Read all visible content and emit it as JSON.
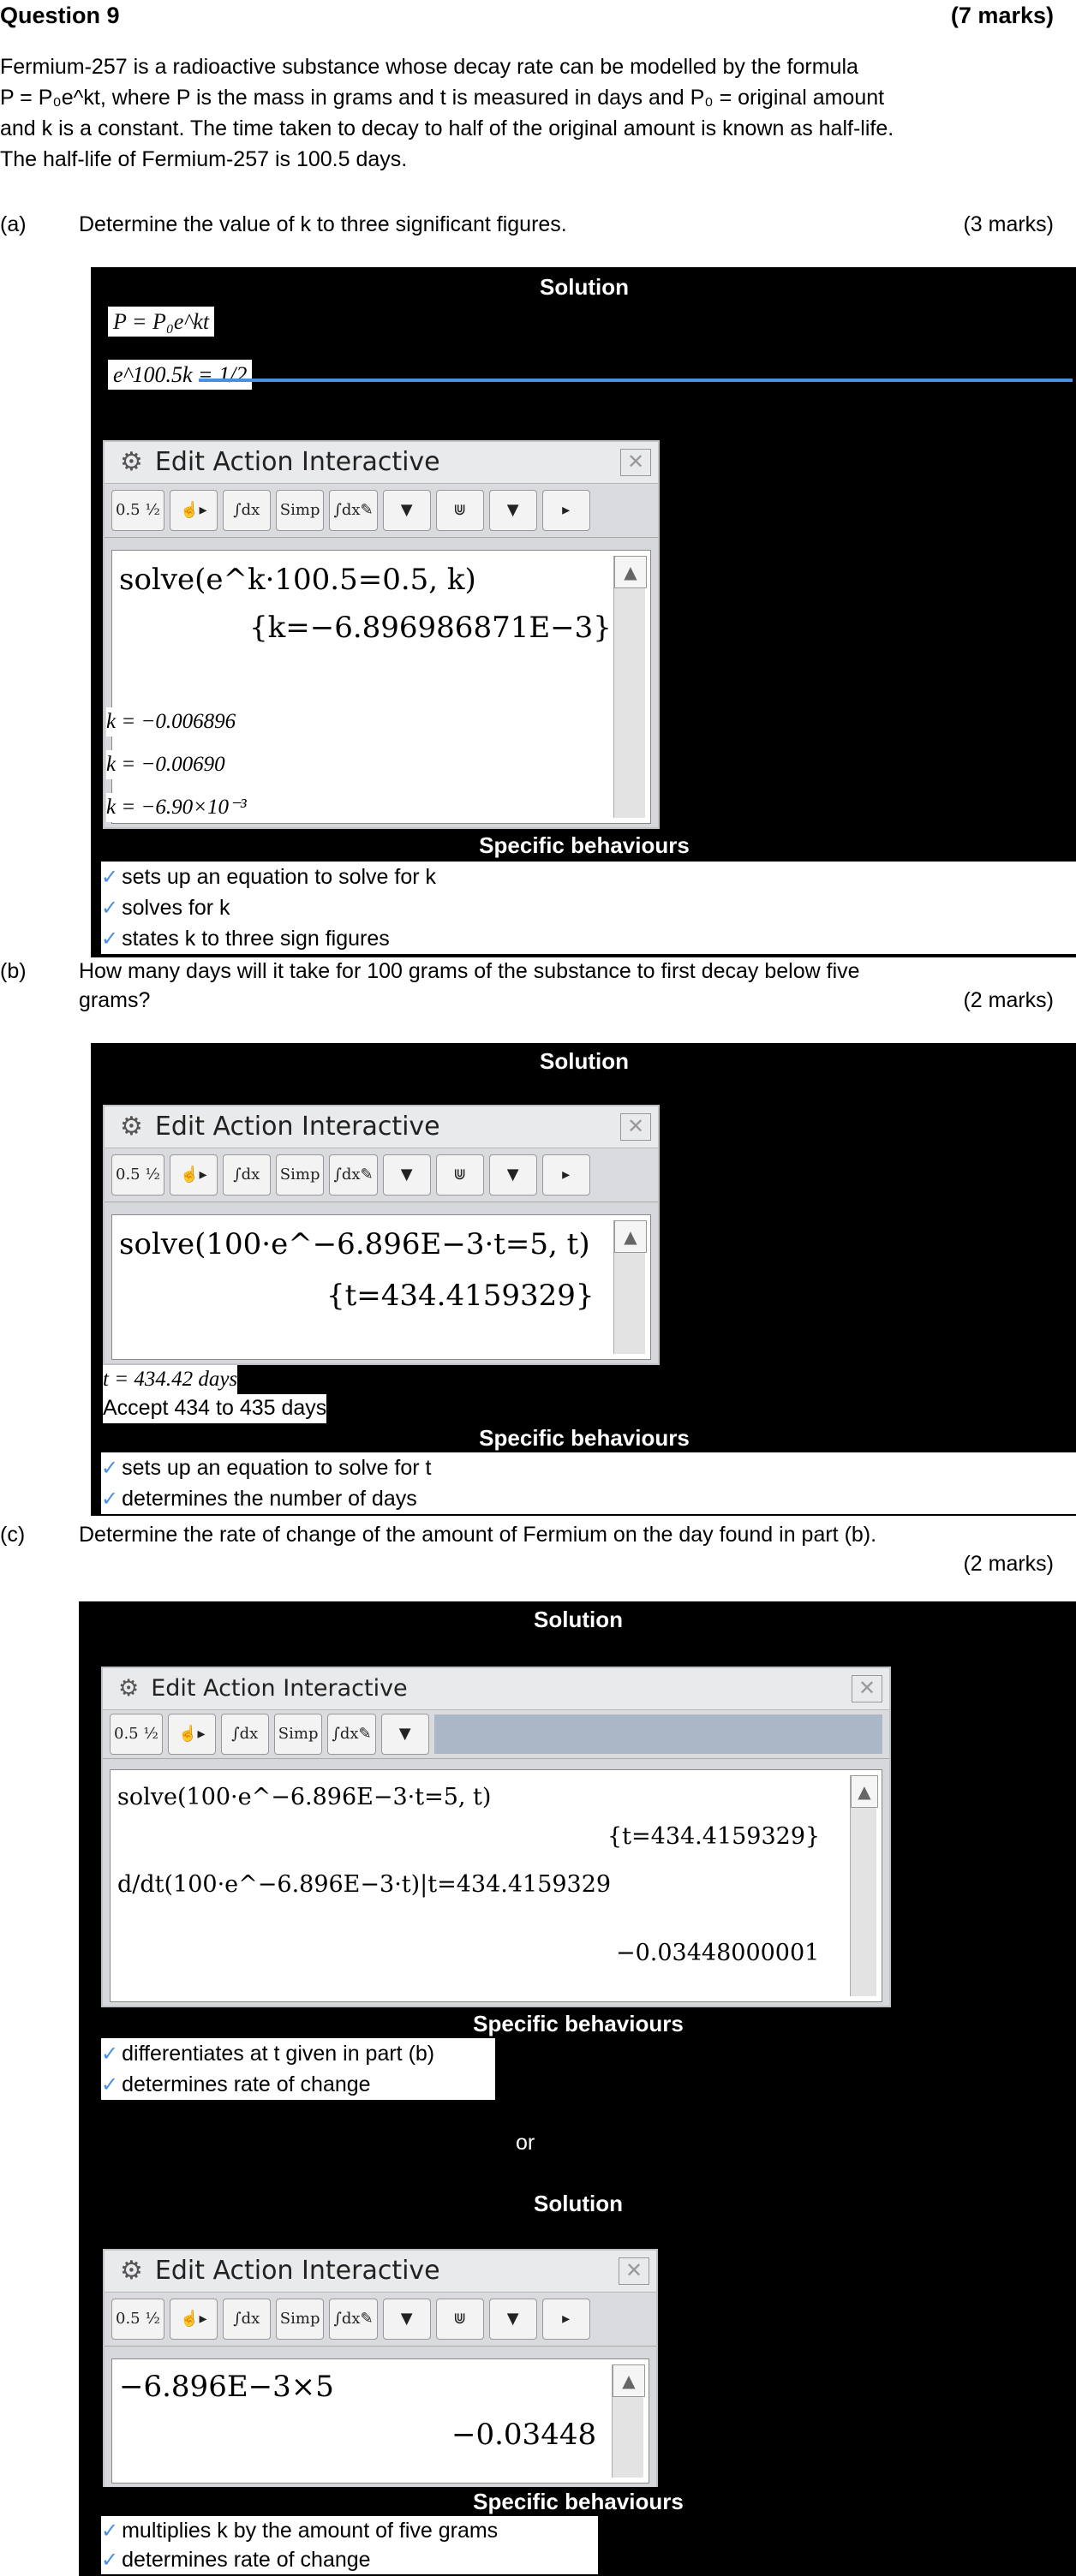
{
  "header": {
    "title": "Question 9",
    "marks": "(7 marks)"
  },
  "intro": {
    "line1": "Fermium-257 is a radioactive substance whose decay rate can be modelled by the formula",
    "line2": "P = P₀e^kt, where P is the mass in grams and t is measured in days and P₀ = original amount",
    "line3": "and k is a constant. The time taken to decay to half of the original amount is known as half-life.",
    "line4": "The half-life of Fermium-257 is 100.5 days."
  },
  "parts": {
    "a": {
      "label": "(a)",
      "question": "Determine the value of k to three significant figures.",
      "marks": "(3 marks)",
      "solution_title": "Solution",
      "eq1": "P = P₀e^kt",
      "eq2": "e^100.5k = 1/2",
      "calc": {
        "menu": "Edit  Action  Interactive",
        "input": "solve(e^k·100.5=0.5, k)",
        "output": "{k=−6.896986871E−3}"
      },
      "answers": [
        "k = −0.006896",
        "k = −0.00690",
        "k = −6.90×10⁻³"
      ],
      "behaviours_title": "Specific behaviours",
      "behaviours": [
        "sets up an equation to solve for k",
        "solves for k",
        "states k to three sign figures"
      ]
    },
    "b": {
      "label": "(b)",
      "question_line1": "How many days will it take for 100 grams of the substance to first decay below five",
      "question_line2": "grams?",
      "marks": "(2 marks)",
      "solution_title": "Solution",
      "calc": {
        "menu": "Edit  Action  Interactive",
        "input": "solve(100·e^−6.896E−3·t=5, t)",
        "output": "{t=434.4159329}"
      },
      "answers": [
        "t = 434.42 days",
        "Accept 434 to 435 days"
      ],
      "behaviours_title": "Specific behaviours",
      "behaviours": [
        "sets up an equation to solve for t",
        "determines the number of days"
      ]
    },
    "c": {
      "label": "(c)",
      "question": "Determine the rate of change of the amount of Fermium on the day found in part (b).",
      "marks": "(2 marks)",
      "solution_title": "Solution",
      "calc": {
        "menu": "Edit  Action  Interactive",
        "line1": "solve(100·e^−6.896E−3·t=5, t)",
        "out1": "{t=434.4159329}",
        "line2": "d/dt(100·e^−6.896E−3·t)|t=434.4159329",
        "out2": "−0.03448000001"
      },
      "behaviours_title": "Specific behaviours",
      "behaviours": [
        "differentiates at t given in part (b)",
        "determines rate of change"
      ],
      "or": "or",
      "solution_title2": "Solution",
      "calc2": {
        "menu": "Edit  Action  Interactive",
        "input": "−6.896E−3×5",
        "output": "−0.03448"
      },
      "behaviours_title2": "Specific behaviours",
      "behaviours2": [
        "multiplies k by the amount of five grams",
        "determines rate of change"
      ]
    }
  },
  "toolbar": {
    "b1": "0.5 ½",
    "b2": "☝▸",
    "b3": "∫dx",
    "b4": "Simp",
    "b5": "∫dx✎",
    "b6": "▼",
    "b7": "⋓",
    "b8": "▼",
    "b9": "▸"
  }
}
